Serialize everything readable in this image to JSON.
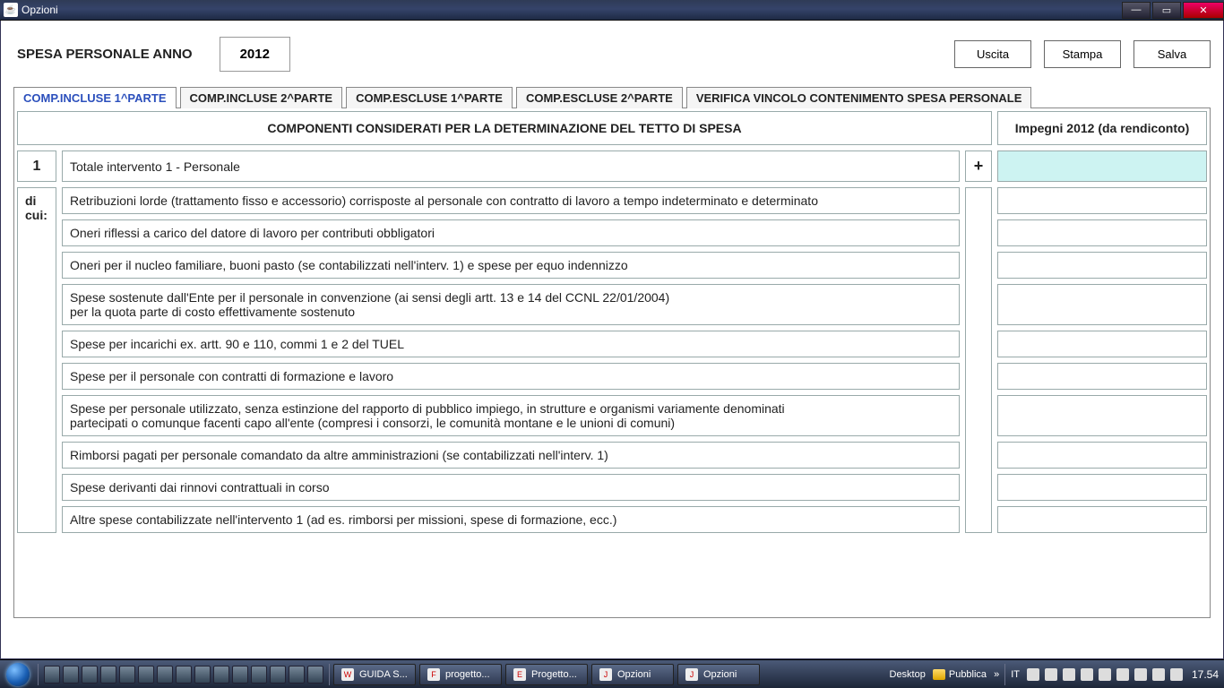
{
  "window": {
    "title": "Opzioni",
    "minimize_glyph": "—",
    "maximize_glyph": "▭",
    "close_glyph": "✕",
    "java_glyph": "☕"
  },
  "toolbar": {
    "heading": "SPESA PERSONALE ANNO",
    "year": "2012",
    "exit": "Uscita",
    "print": "Stampa",
    "save": "Salva"
  },
  "tabs": [
    {
      "label": "COMP.INCLUSE 1^PARTE"
    },
    {
      "label": "COMP.INCLUSE 2^PARTE"
    },
    {
      "label": "COMP.ESCLUSE 1^PARTE"
    },
    {
      "label": "COMP.ESCLUSE 2^PARTE"
    },
    {
      "label": "VERIFICA VINCOLO CONTENIMENTO SPESA PERSONALE"
    }
  ],
  "columns": {
    "main": "COMPONENTI CONSIDERATI PER LA DETERMINAZIONE DEL TETTO DI SPESA",
    "amount": "Impegni 2012 (da rendiconto)"
  },
  "rows": {
    "n1": "1",
    "r1": {
      "label": "Totale intervento 1 - Personale",
      "sign": "+",
      "value": ""
    },
    "dicui": "di cui:",
    "sub": [
      {
        "label": "Retribuzioni lorde (trattamento fisso e accessorio) corrisposte al personale con contratto di lavoro a tempo indeterminato e determinato",
        "value": ""
      },
      {
        "label": "Oneri riflessi a carico del datore di lavoro per contributi obbligatori",
        "value": ""
      },
      {
        "label": "Oneri per il nucleo familiare, buoni pasto (se contabilizzati nell'interv. 1) e spese per equo indennizzo",
        "value": ""
      },
      {
        "label": "Spese sostenute dall'Ente per il personale in convenzione (ai sensi degli artt. 13 e 14 del CCNL 22/01/2004)",
        "label2": "per la quota parte di costo effettivamente sostenuto",
        "value": ""
      },
      {
        "label": "Spese per incarichi ex. artt. 90 e 110, commi 1 e 2 del TUEL",
        "value": ""
      },
      {
        "label": "Spese per il personale con contratti di formazione e lavoro",
        "value": ""
      },
      {
        "label": "Spese per personale utilizzato, senza estinzione del rapporto di pubblico impiego, in strutture e organismi variamente denominati",
        "label2": "partecipati o comunque facenti capo all'ente (compresi i consorzi, le comunità montane e le unioni di comuni)",
        "value": ""
      },
      {
        "label": "Rimborsi pagati per personale comandato da altre amministrazioni (se contabilizzati nell'interv. 1)",
        "value": ""
      },
      {
        "label": "Spese derivanti dai rinnovi contrattuali in corso",
        "value": ""
      },
      {
        "label": "Altre spese contabilizzate nell'intervento 1 (ad es. rimborsi per missioni, spese di formazione, ecc.)",
        "value": ""
      }
    ]
  },
  "taskbar": {
    "items": [
      {
        "label": "GUIDA S...",
        "icon": "W"
      },
      {
        "label": "progetto...",
        "icon": "F"
      },
      {
        "label": "Progetto...",
        "icon": "E"
      },
      {
        "label": "Opzioni",
        "icon": "J"
      },
      {
        "label": "Opzioni",
        "icon": "J"
      }
    ],
    "desktop": "Desktop",
    "pubblica": "Pubblica",
    "lang": "IT",
    "time": "17.54",
    "chevrons": "»"
  }
}
